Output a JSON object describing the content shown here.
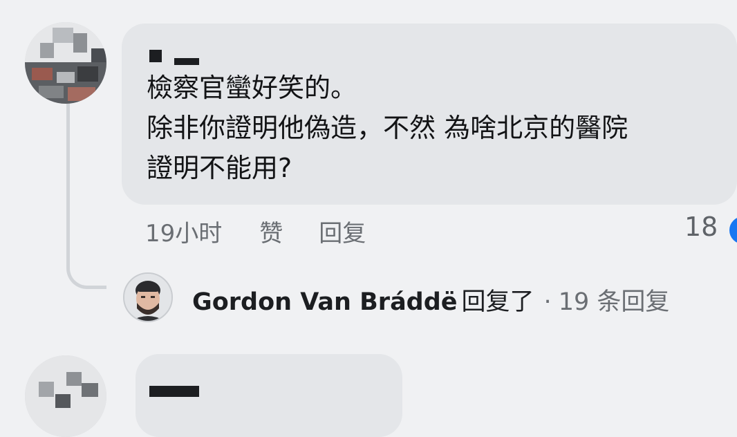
{
  "comment1": {
    "text": "檢察官蠻好笑的。\n除非你證明他偽造，不然 為啥北京的醫院\n證明不能用?",
    "time": "19小时",
    "like_label": "赞",
    "reply_label": "回复",
    "reaction_count": "18",
    "reaction_icon": "like-reaction"
  },
  "replies": {
    "name": "Gordon Van Bráddë",
    "verb": "回复了",
    "separator": "·",
    "count_text": "19 条回复"
  },
  "colors": {
    "background": "#f0f1f3",
    "bubble": "#e4e6e9",
    "secondary_text": "#6a6e73",
    "reaction_blue": "#1877f2"
  }
}
